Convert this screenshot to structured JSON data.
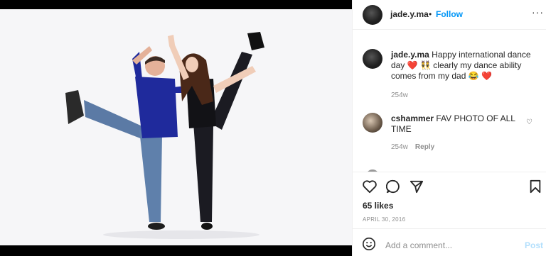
{
  "post": {
    "image_alt": "Man in blue shirt and woman in black posing mid-dance kick on white studio background"
  },
  "header": {
    "username": "jade.y.ma",
    "separator": "•",
    "follow_label": "Follow",
    "more_label": "···"
  },
  "caption": {
    "username": "jade.y.ma",
    "text_part1": "Happy international dance day",
    "emoji_heart": "❤️",
    "emoji_dancers": "👯",
    "text_part2": "clearly my dance ability comes from my dad",
    "emoji_laugh": "😂",
    "time": "254w"
  },
  "comments": [
    {
      "username": "cshammer",
      "text": "FAV PHOTO OF ALL TIME",
      "time": "254w",
      "reply_label": "Reply"
    }
  ],
  "actions": {
    "likes": "65 likes",
    "date": "APRIL 30, 2016"
  },
  "add_comment": {
    "placeholder": "Add a comment...",
    "post_label": "Post"
  },
  "colors": {
    "follow": "#0095f6",
    "post_disabled": "#b2dffc",
    "meta_gray": "#8e8e8e",
    "text": "#262626"
  }
}
